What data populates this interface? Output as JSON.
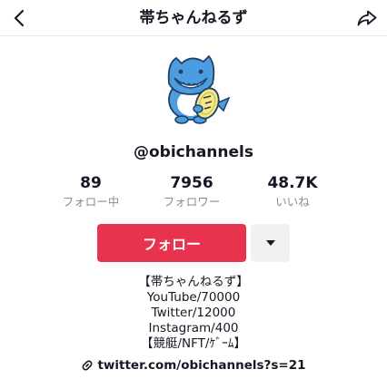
{
  "header": {
    "title": "帯ちゃんねるず",
    "back_icon": "chevron-left-icon",
    "share_icon": "share-arrow-icon"
  },
  "profile": {
    "username": "@obichannels",
    "avatar_icon": "shark-mascot-avatar"
  },
  "stats": [
    {
      "value": "89",
      "label": "フォロー中"
    },
    {
      "value": "7956",
      "label": "フォロワー"
    },
    {
      "value": "48.7K",
      "label": "いいね"
    }
  ],
  "actions": {
    "follow_label": "フォロー",
    "more_icon": "caret-down-icon",
    "follow_color": "#e8334f"
  },
  "bio": [
    "【帯ちゃんねるず】",
    "YouTube/70000",
    "Twitter/12000",
    "Instagram/400",
    "【競艇/NFT/ｹﾞｰﾑ】"
  ],
  "link": {
    "icon": "link-icon",
    "text": "twitter.com/obichannels?s=21"
  }
}
